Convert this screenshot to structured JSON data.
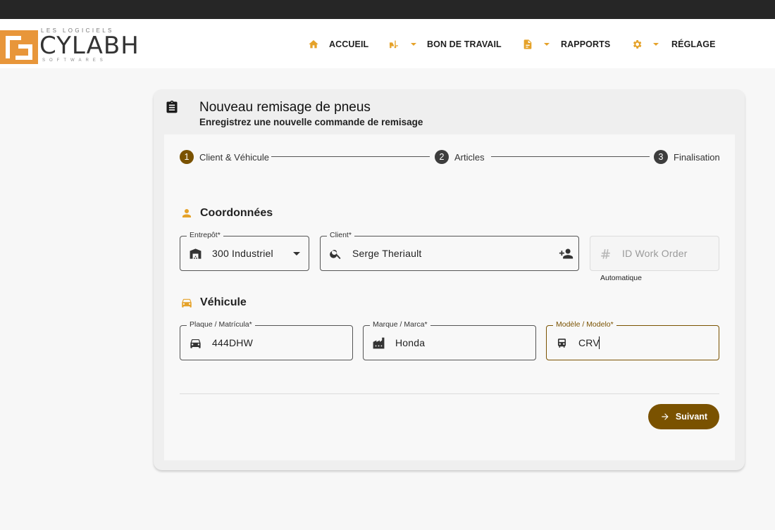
{
  "logo": {
    "small_text": "LES LOGICIELS",
    "name": "CYLABH",
    "sub_text": "SOFTWARES"
  },
  "nav": {
    "home_label": "ACCUEIL",
    "work_order_label": "BON DE TRAVAIL",
    "reports_label": "RAPPORTS",
    "settings_label": "RÉGLAGE"
  },
  "colors": {
    "accent": "#e5a229",
    "primary": "#7a5200",
    "step_inactive": "#3d3d3d"
  },
  "page": {
    "title": "Nouveau remisage de pneus",
    "subtitle": "Enregistrez une nouvelle commande de remisage"
  },
  "stepper": {
    "steps": [
      {
        "num": "1",
        "label": "Client & Véhicule"
      },
      {
        "num": "2",
        "label": "Articles"
      },
      {
        "num": "3",
        "label": "Finalisation"
      }
    ]
  },
  "sections": {
    "coords_title": "Coordonnées",
    "vehicle_title": "Véhicule"
  },
  "fields": {
    "warehouse": {
      "label": "Entrepôt*",
      "value": "300 Industriel",
      "icon": "warehouse-icon"
    },
    "client": {
      "label": "Client*",
      "value": "Serge Theriault",
      "icon": "search-icon"
    },
    "work_order": {
      "placeholder": "ID Work Order",
      "hint": "Automatique",
      "icon": "hash-icon"
    },
    "plate": {
      "label": "Plaque / Matrícula*",
      "value": "444DHW",
      "icon": "car-icon"
    },
    "make": {
      "label": "Marque / Marca*",
      "value": "Honda",
      "icon": "factory-icon"
    },
    "model": {
      "label": "Modèle / Modelo*",
      "value": "CRV",
      "icon": "car-front-icon"
    }
  },
  "actions": {
    "next_label": "Suivant"
  }
}
